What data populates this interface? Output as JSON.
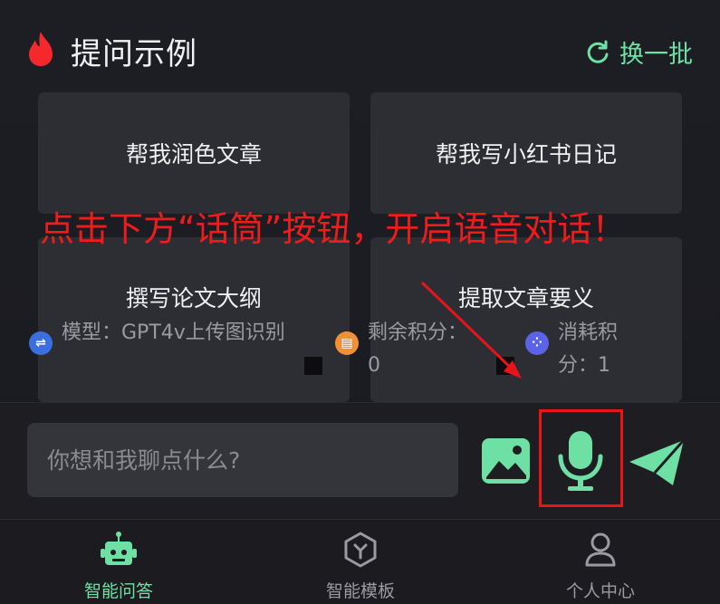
{
  "header": {
    "title": "提问示例",
    "refresh_label": "换一批"
  },
  "examples": [
    {
      "label": "帮我润色文章"
    },
    {
      "label": "帮我写小红书日记"
    },
    {
      "label": "撰写论文大纲"
    },
    {
      "label": "提取文章要义"
    }
  ],
  "annotation": "点击下方“话筒”按钮，开启语音对话！",
  "info": {
    "model": "模型：GPT4v上传图识别",
    "remaining": "剩余积分：0",
    "cost": "消耗积分：1"
  },
  "input": {
    "placeholder": "你想和我聊点什么?"
  },
  "tabs": [
    {
      "label": "智能问答",
      "active": true
    },
    {
      "label": "智能模板",
      "active": false
    },
    {
      "label": "个人中心",
      "active": false
    }
  ],
  "colors": {
    "accent": "#6fe0a4",
    "annotation": "#ee1c1c",
    "flame": "#f5282c"
  }
}
